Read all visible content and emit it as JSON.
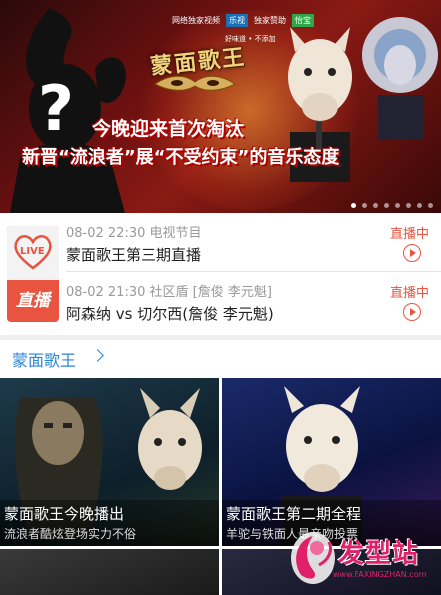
{
  "banner": {
    "show_title": "蒙面歌王",
    "line1": "今晚迎来首次淘汰",
    "line2": "新晋“流浪者”展“不受约束”的音乐态度",
    "partner_label_1": "网络独家视频",
    "partner_badge_1": "乐视",
    "partner_label_2": "独家赞助",
    "partner_badge_2": "怡宝",
    "partner_sub": "好味道 • 不添加",
    "question_mark": "?",
    "carousel_count": 8,
    "carousel_active_index": 0
  },
  "live": {
    "badge_top": "LIVE",
    "badge_bottom": "直播",
    "items": [
      {
        "meta": "08-02 22:30 电视节目",
        "title": "蒙面歌王第三期直播",
        "status": "直播中"
      },
      {
        "meta": "08-02 21:30 社区盾 [詹俊 李元魁]",
        "title": "阿森纳 vs 切尔西(詹俊 李元魁)",
        "status": "直播中"
      }
    ]
  },
  "section": {
    "title": "蒙面歌王"
  },
  "cards": [
    {
      "title": "蒙面歌王今晚播出",
      "subtitle": "流浪者酷炫登场实力不俗"
    },
    {
      "title": "蒙面歌王第二期全程",
      "subtitle": "羊驼与铁面人最亲吻投票"
    }
  ],
  "watermark": {
    "text": "发型站",
    "url": "www.FAXINGZHAN.com"
  },
  "colors": {
    "accent_red": "#e8543f",
    "link_blue": "#2a86d8",
    "watermark_pink": "#e0216a"
  }
}
